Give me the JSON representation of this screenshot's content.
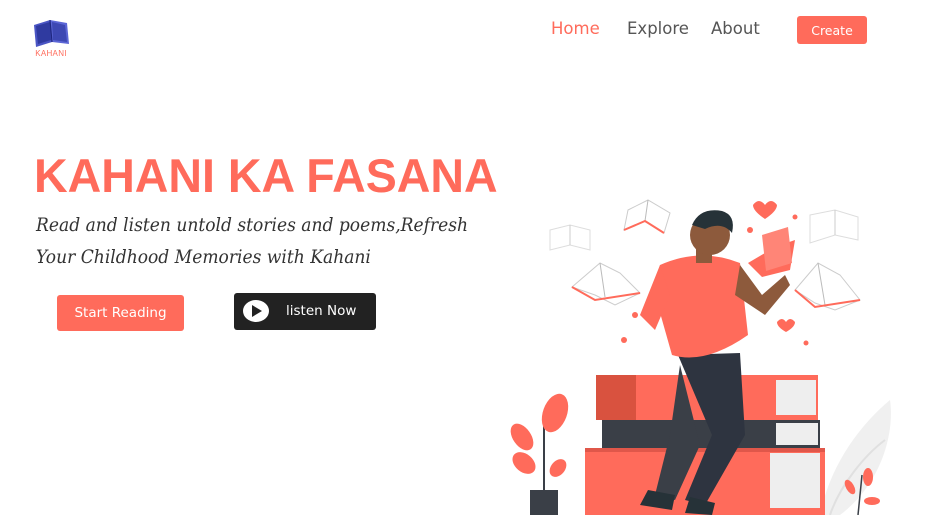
{
  "brand": {
    "name": "KAHANI",
    "logo_icon": "book-icon"
  },
  "nav": {
    "home": "Home",
    "explore": "Explore",
    "about": "About",
    "create": "Create"
  },
  "hero": {
    "title": "KAHANI KA FASANA",
    "subtitle": "Read and listen untold stories and poems,Refresh Your Childhood Memories with Kahani",
    "start_button": "Start Reading",
    "listen_button": "listen Now",
    "listen_icon": "play-icon",
    "illustration": "man-reading-book-on-stack-of-books"
  },
  "colors": {
    "accent": "#ff6b5b",
    "dark": "#222222",
    "text": "#333333",
    "nav_text": "#555555"
  }
}
